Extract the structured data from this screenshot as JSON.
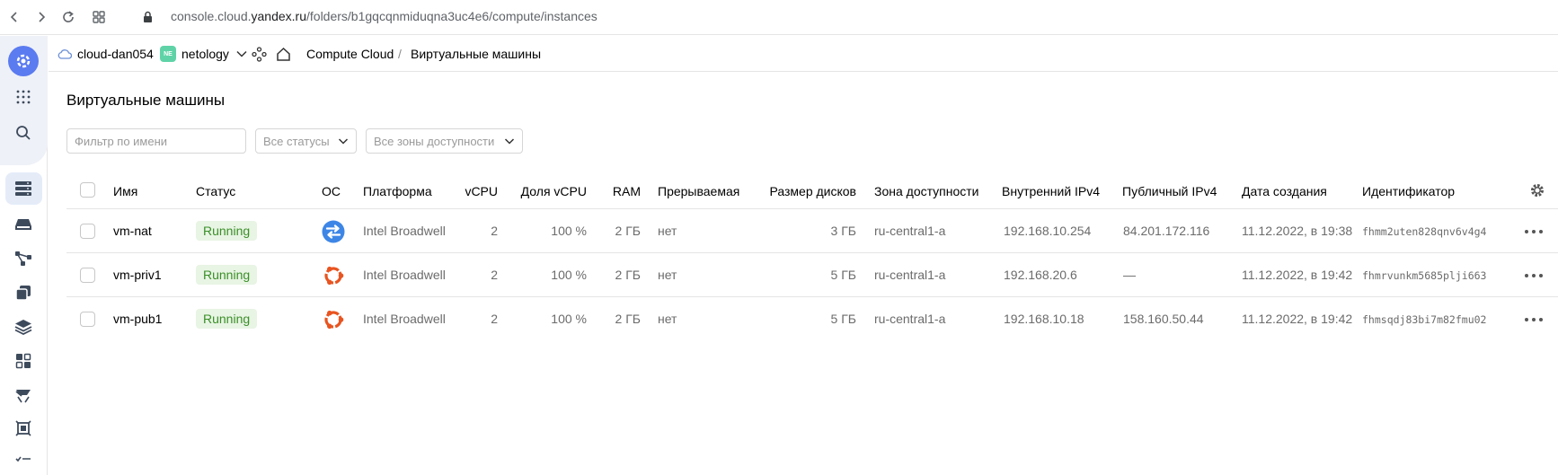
{
  "browser": {
    "url_host": "console.cloud.",
    "url_domain": "yandex.ru",
    "url_path": "/folders/b1gqcqnmiduqna3uc4e6/compute/instances"
  },
  "header": {
    "cloud": "cloud-dan054",
    "folder_badge": "NE",
    "folder": "netology",
    "breadcrumb_service": "Compute Cloud",
    "breadcrumb_sep": "/",
    "breadcrumb_page": "Виртуальные машины"
  },
  "page": {
    "title": "Виртуальные машины"
  },
  "filters": {
    "name_placeholder": "Фильтр по имени",
    "status_value": "Все статусы",
    "zone_value": "Все зоны доступности"
  },
  "table": {
    "columns": {
      "name": "Имя",
      "status": "Статус",
      "os": "ОС",
      "platform": "Платформа",
      "vcpu": "vCPU",
      "vcpu_share": "Доля vCPU",
      "ram": "RAM",
      "preemptible": "Прерываемая",
      "disk_size": "Размер дисков",
      "zone": "Зона доступности",
      "internal_ipv4": "Внутренний IPv4",
      "public_ipv4": "Публичный IPv4",
      "created": "Дата создания",
      "id": "Идентификатор"
    },
    "rows": [
      {
        "name": "vm-nat",
        "status": "Running",
        "os_icon": "nat-instance-icon",
        "platform": "Intel Broadwell",
        "vcpu": "2",
        "vcpu_share": "100 %",
        "ram": "2 ГБ",
        "preemptible": "нет",
        "disk_size": "3 ГБ",
        "zone": "ru-central1-a",
        "internal_ipv4": "192.168.10.254",
        "public_ipv4": "84.201.172.116",
        "created": "11.12.2022, в 19:38",
        "id": "fhmm2uten828qnv6v4g4"
      },
      {
        "name": "vm-priv1",
        "status": "Running",
        "os_icon": "ubuntu-icon",
        "platform": "Intel Broadwell",
        "vcpu": "2",
        "vcpu_share": "100 %",
        "ram": "2 ГБ",
        "preemptible": "нет",
        "disk_size": "5 ГБ",
        "zone": "ru-central1-a",
        "internal_ipv4": "192.168.20.6",
        "public_ipv4": "—",
        "created": "11.12.2022, в 19:42",
        "id": "fhmrvunkm5685plji663"
      },
      {
        "name": "vm-pub1",
        "status": "Running",
        "os_icon": "ubuntu-icon",
        "platform": "Intel Broadwell",
        "vcpu": "2",
        "vcpu_share": "100 %",
        "ram": "2 ГБ",
        "preemptible": "нет",
        "disk_size": "5 ГБ",
        "zone": "ru-central1-a",
        "internal_ipv4": "192.168.10.18",
        "public_ipv4": "158.160.50.44",
        "created": "11.12.2022, в 19:42",
        "id": "fhmsqdj83bi7m82fmu02"
      }
    ]
  },
  "colors": {
    "status_running_bg": "#e8f4e4",
    "status_running_text": "#3a8f28",
    "brand_blue": "#5b7bf0",
    "ubuntu_orange": "#e95420"
  }
}
